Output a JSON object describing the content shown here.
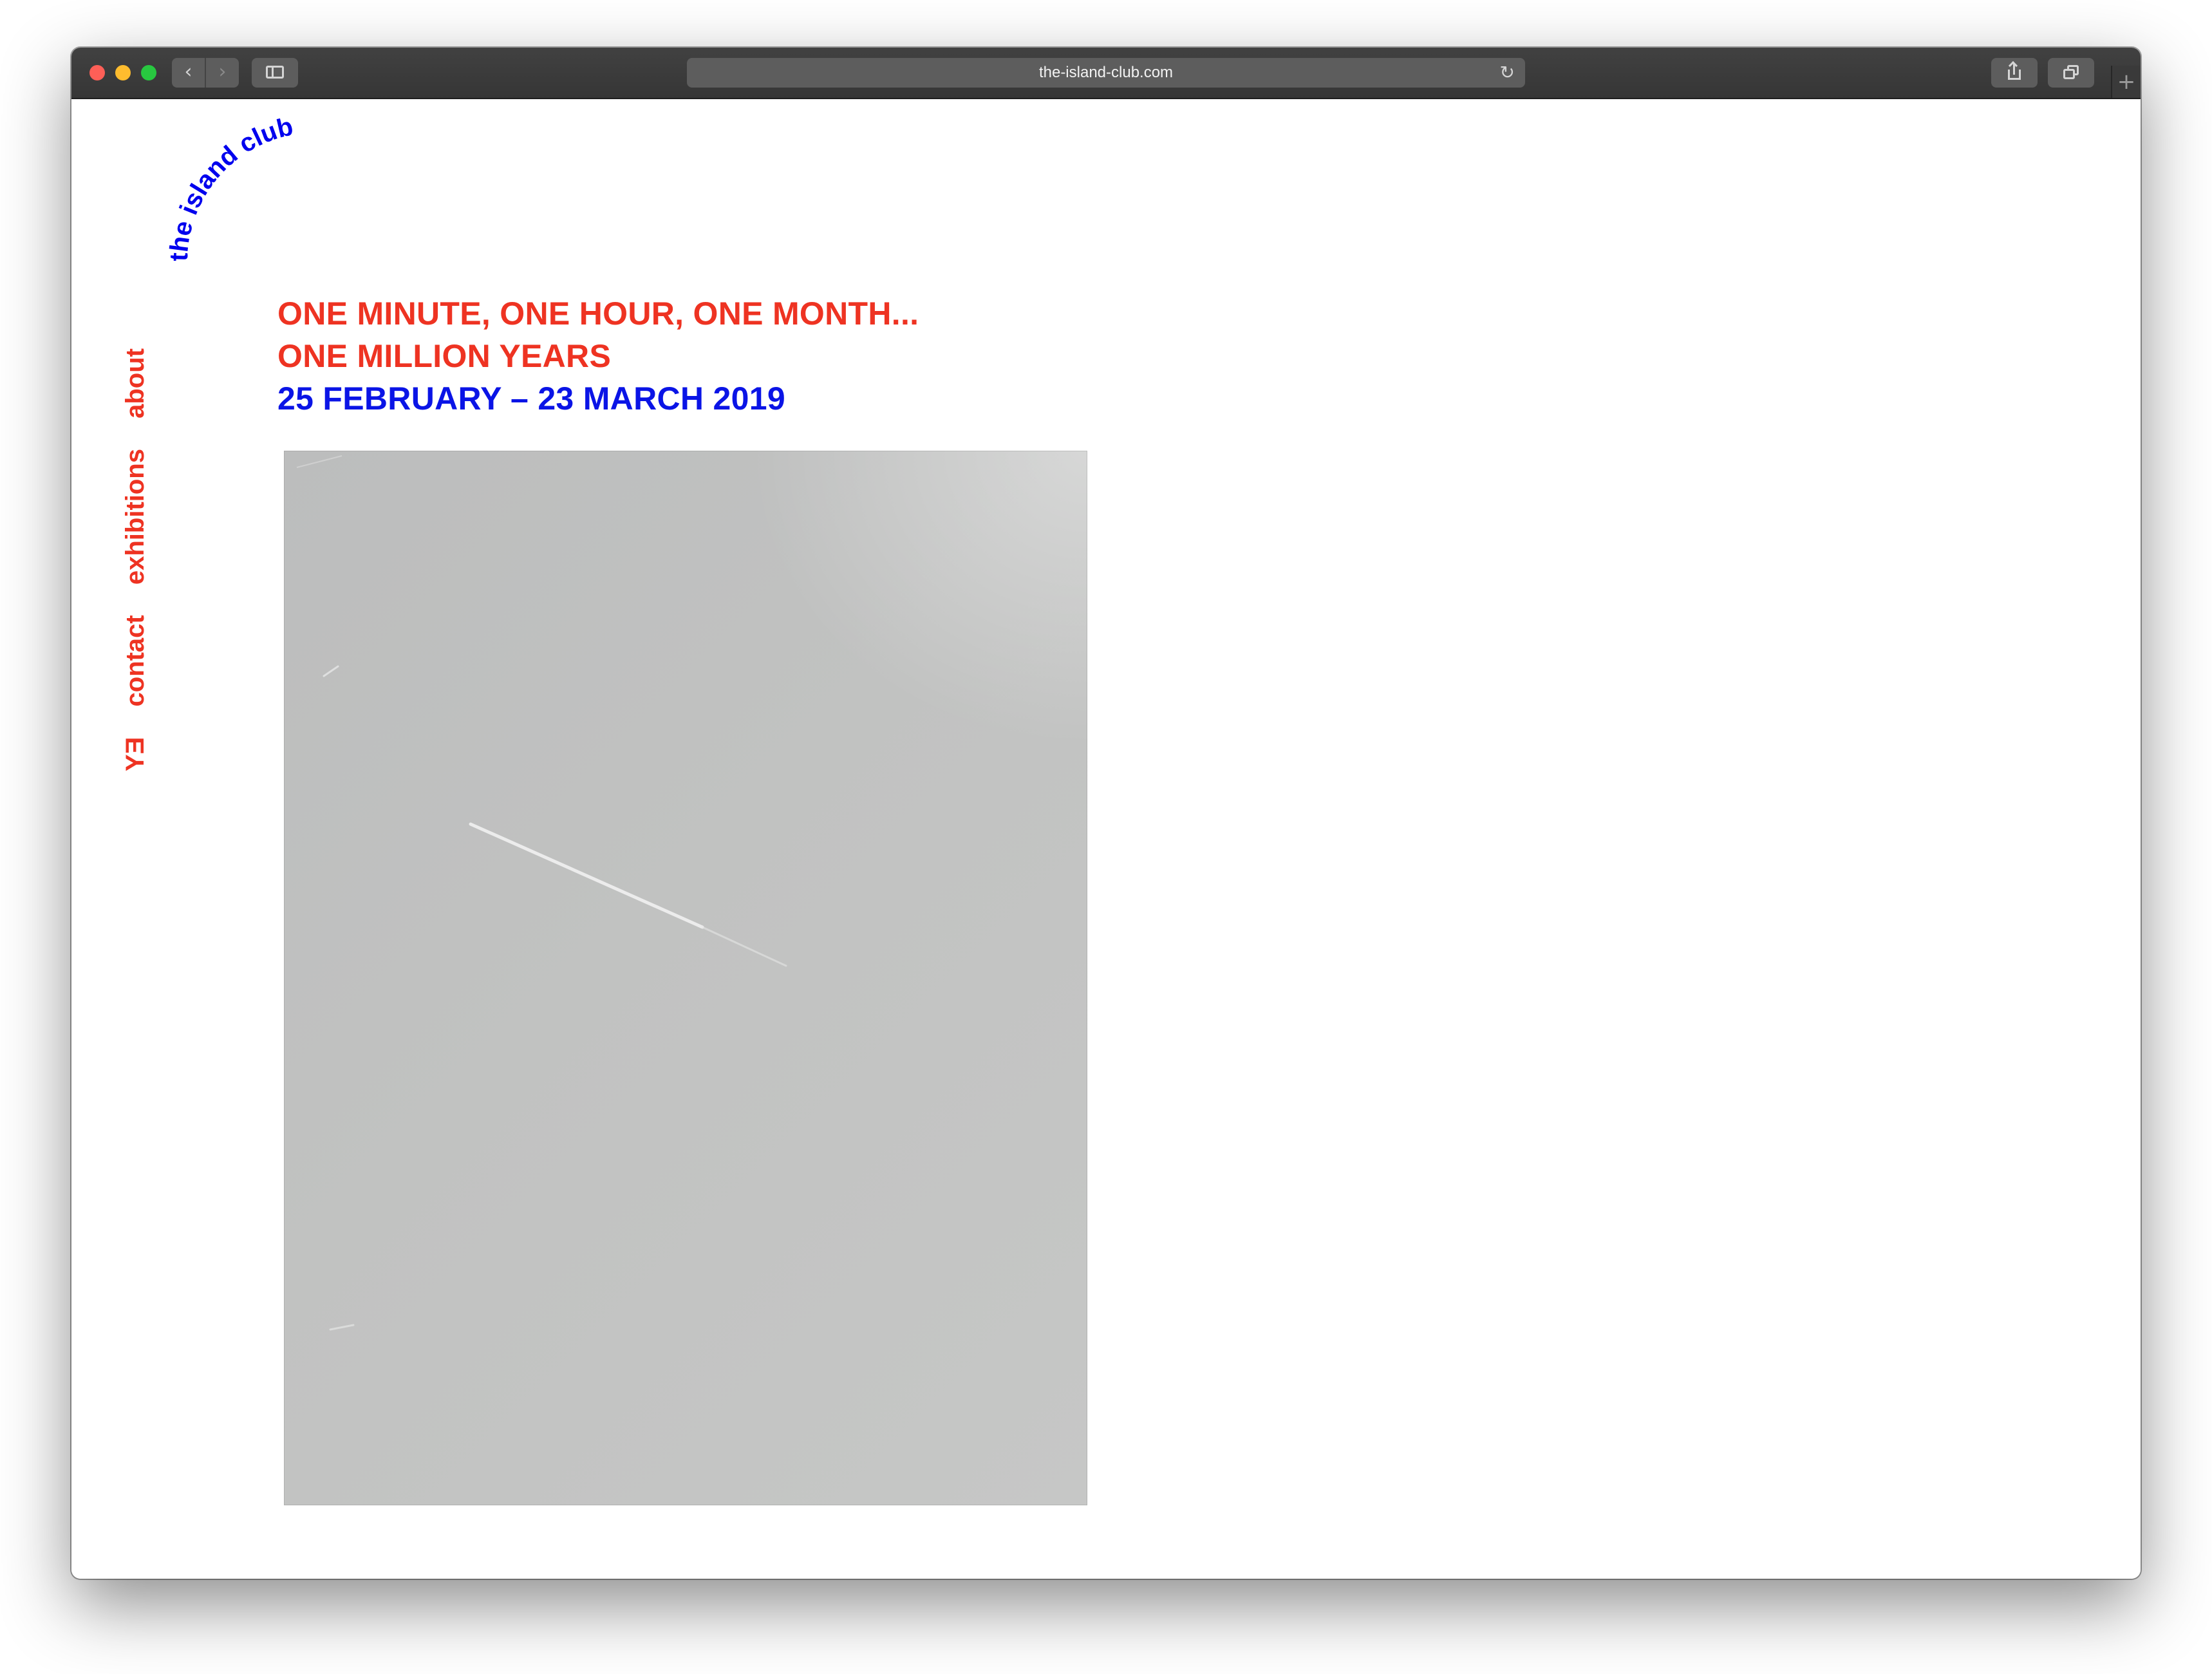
{
  "browser": {
    "url": "the-island-club.com",
    "back_icon": "‹",
    "forward_icon": "›",
    "reload_icon": "↻",
    "newtab_icon": "+"
  },
  "site": {
    "logo_text": "the island club",
    "nav": [
      {
        "label": "about"
      },
      {
        "label": "exhibitions"
      },
      {
        "label": "contact"
      },
      {
        "label": "EY"
      }
    ]
  },
  "exhibition": {
    "title_line1": "ONE MINUTE, ONE HOUR, ONE MONTH...",
    "title_line2": "ONE MILLION YEARS",
    "dates": "25 FEBRUARY – 23 MARCH 2019"
  },
  "colors": {
    "red": "#ee3322",
    "blue": "#0a14e6",
    "artwork_gray": "#c0c1c0"
  }
}
